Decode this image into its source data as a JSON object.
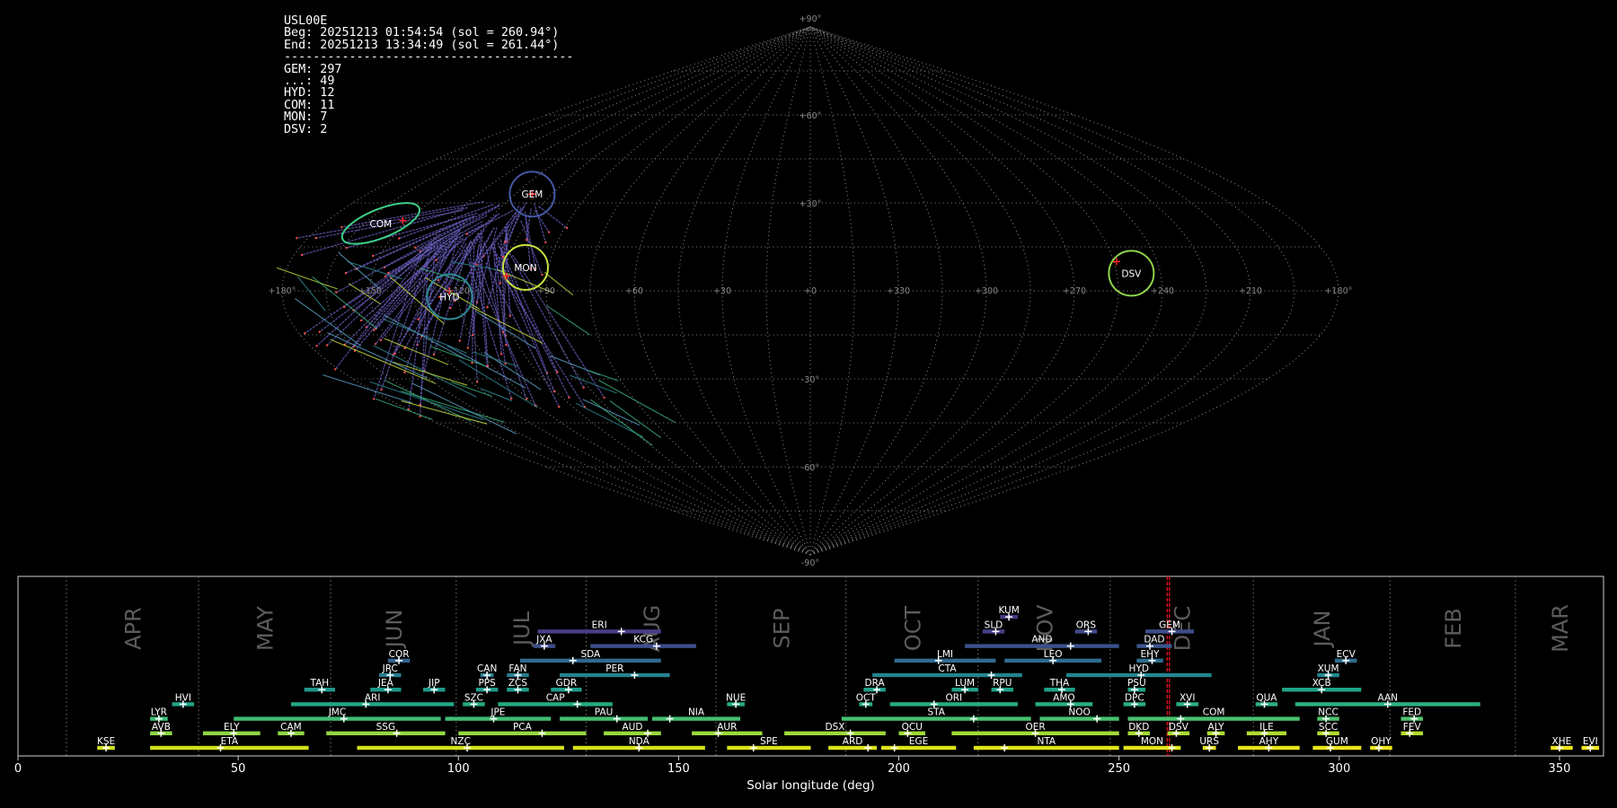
{
  "chart_data": [
    {
      "type": "scatter",
      "projection": "sinusoidal",
      "panel": "sky",
      "info_lines": [
        "USL00E",
        "Beg: 20251213 01:54:54 (sol = 260.94°)",
        "End: 20251213 13:34:49 (sol = 261.44°)",
        "----------------------------------------",
        "GEM: 297",
        "...: 49",
        "HYD: 12",
        "COM: 11",
        "MON: 7",
        "DSV: 2"
      ],
      "lon_tick_labels": [
        "+180°",
        "+150",
        "+120",
        "+90",
        "+60",
        "+30",
        "+0",
        "+330",
        "+300",
        "+270",
        "+240",
        "+210",
        "+180°"
      ],
      "lat_tick_labels": [
        "+90°",
        "+60°",
        "+30°",
        "-30°",
        "-60°",
        "-90°"
      ],
      "radiants": [
        {
          "code": "COM",
          "lon": 159,
          "lat": 23,
          "color": "#3ecf86",
          "marker_lon": 152,
          "marker_lat": 24
        },
        {
          "code": "GEM",
          "lon": 113,
          "lat": 33,
          "color": "#4458a0",
          "marker_lon": 113,
          "marker_lat": 33
        },
        {
          "code": "MON",
          "lon": 98,
          "lat": 8,
          "color": "#c8e040",
          "marker_lon": 104,
          "marker_lat": 5
        },
        {
          "code": "HYD",
          "lon": 123,
          "lat": -2,
          "color": "#2e8a96",
          "marker_lon": 123,
          "marker_lat": 0
        },
        {
          "code": "DSV",
          "lon": -110,
          "lat": 6,
          "color": "#8ed34a",
          "marker_lon": -106,
          "marker_lat": 10
        }
      ],
      "grid": true
    },
    {
      "type": "timeline",
      "panel": "shower-activity",
      "xlabel": "Solar longitude (deg)",
      "xlim": [
        0,
        360
      ],
      "x_ticks": [
        "0",
        "50",
        "100",
        "150",
        "200",
        "250",
        "300",
        "350"
      ],
      "x_tick_values": [
        0,
        50,
        100,
        150,
        200,
        250,
        300,
        350
      ],
      "months": [
        {
          "label": "APR",
          "start": 11,
          "end": 41
        },
        {
          "label": "MAY",
          "start": 41,
          "end": 71
        },
        {
          "label": "JUN",
          "start": 71,
          "end": 99.5
        },
        {
          "label": "JUL",
          "start": 99.5,
          "end": 129
        },
        {
          "label": "AUG",
          "start": 129,
          "end": 158.5
        },
        {
          "label": "SEP",
          "start": 158.5,
          "end": 188
        },
        {
          "label": "OCT",
          "start": 188,
          "end": 218
        },
        {
          "label": "NOV",
          "start": 218,
          "end": 248
        },
        {
          "label": "DEC",
          "start": 248,
          "end": 280.5
        },
        {
          "label": "JAN",
          "start": 280.5,
          "end": 311.5
        },
        {
          "label": "FEB",
          "start": 311.5,
          "end": 340
        },
        {
          "label": "MAR",
          "start": 340,
          "end": 370
        }
      ],
      "current_sol": [
        260.94,
        261.44
      ],
      "showers": [
        {
          "code": "KUM",
          "row": 9,
          "start": 223,
          "end": 227,
          "peak": 225,
          "color": "#483a84"
        },
        {
          "code": "ERI",
          "row": 8,
          "start": 118,
          "end": 146,
          "peak": 137,
          "color": "#463e86"
        },
        {
          "code": "SLD",
          "row": 8,
          "start": 219,
          "end": 224,
          "peak": 222,
          "color": "#443f87"
        },
        {
          "code": "ORS",
          "row": 8,
          "start": 240,
          "end": 245,
          "peak": 243,
          "color": "#3f4a8a"
        },
        {
          "code": "GEM",
          "row": 8,
          "start": 256,
          "end": 267,
          "peak": 262,
          "color": "#3d4d8a"
        },
        {
          "code": "JXA",
          "row": 7,
          "start": 117,
          "end": 122,
          "peak": 119.5,
          "color": "#3d4f8a"
        },
        {
          "code": "KCG",
          "row": 7,
          "start": 130,
          "end": 154,
          "peak": 145,
          "color": "#3d4f8a"
        },
        {
          "code": "AND",
          "row": 7,
          "start": 215,
          "end": 250,
          "peak": 239,
          "color": "#3b528b"
        },
        {
          "code": "DAD",
          "row": 7,
          "start": 254,
          "end": 262,
          "peak": 257,
          "color": "#39568c"
        },
        {
          "code": "COR",
          "row": 6,
          "start": 84,
          "end": 89,
          "peak": 86.5,
          "color": "#33638d"
        },
        {
          "code": "SDA",
          "row": 6,
          "start": 114,
          "end": 146,
          "peak": 126,
          "color": "#31688e"
        },
        {
          "code": "LMI",
          "row": 6,
          "start": 199,
          "end": 222,
          "peak": 209,
          "color": "#306a8e"
        },
        {
          "code": "LEO",
          "row": 6,
          "start": 224,
          "end": 246,
          "peak": 235,
          "color": "#2f6c8e"
        },
        {
          "code": "EHY",
          "row": 6,
          "start": 254,
          "end": 260,
          "peak": 257.5,
          "color": "#2f6d8e"
        },
        {
          "code": "ECV",
          "row": 6,
          "start": 299,
          "end": 304,
          "peak": 301.5,
          "color": "#2f6c8e"
        },
        {
          "code": "JRC",
          "row": 5,
          "start": 82,
          "end": 87,
          "peak": 84.5,
          "color": "#297b8e"
        },
        {
          "code": "CAN",
          "row": 5,
          "start": 105,
          "end": 108,
          "peak": 106.5,
          "color": "#287c8e"
        },
        {
          "code": "FAN",
          "row": 5,
          "start": 111,
          "end": 116,
          "peak": 113.5,
          "color": "#277f8e"
        },
        {
          "code": "PER",
          "row": 5,
          "start": 123,
          "end": 148,
          "peak": 140,
          "color": "#26818e"
        },
        {
          "code": "CTA",
          "row": 5,
          "start": 194,
          "end": 228,
          "peak": 221,
          "color": "#25848e"
        },
        {
          "code": "HYD",
          "row": 5,
          "start": 238,
          "end": 271,
          "peak": 255,
          "color": "#24868e"
        },
        {
          "code": "XUM",
          "row": 5,
          "start": 295,
          "end": 300,
          "peak": 297.5,
          "color": "#23888e"
        },
        {
          "code": "TAH",
          "row": 4,
          "start": 65,
          "end": 72,
          "peak": 69,
          "color": "#1f958b"
        },
        {
          "code": "JEA",
          "row": 4,
          "start": 80,
          "end": 87,
          "peak": 84,
          "color": "#1f968b"
        },
        {
          "code": "JIP",
          "row": 4,
          "start": 92,
          "end": 97,
          "peak": 94.5,
          "color": "#1f988b"
        },
        {
          "code": "PPS",
          "row": 4,
          "start": 104,
          "end": 109,
          "peak": 106.5,
          "color": "#1f9a8a"
        },
        {
          "code": "ZCS",
          "row": 4,
          "start": 111,
          "end": 116,
          "peak": 113.5,
          "color": "#1f9a8a"
        },
        {
          "code": "GDR",
          "row": 4,
          "start": 121,
          "end": 128,
          "peak": 125,
          "color": "#1f9b8a"
        },
        {
          "code": "DRA",
          "row": 4,
          "start": 192,
          "end": 197,
          "peak": 195,
          "color": "#1f9e89"
        },
        {
          "code": "LUM",
          "row": 4,
          "start": 212,
          "end": 218,
          "peak": 215,
          "color": "#1fa088"
        },
        {
          "code": "RPU",
          "row": 4,
          "start": 221,
          "end": 226,
          "peak": 223,
          "color": "#1fa088"
        },
        {
          "code": "THA",
          "row": 4,
          "start": 233,
          "end": 240,
          "peak": 237,
          "color": "#1fa187"
        },
        {
          "code": "PSU",
          "row": 4,
          "start": 252,
          "end": 256,
          "peak": 253.5,
          "color": "#1fa287"
        },
        {
          "code": "XCB",
          "row": 4,
          "start": 287,
          "end": 305,
          "peak": 296,
          "color": "#1fa287"
        },
        {
          "code": "HVI",
          "row": 3,
          "start": 35,
          "end": 40,
          "peak": 37.5,
          "color": "#20a386"
        },
        {
          "code": "ARI",
          "row": 3,
          "start": 62,
          "end": 99,
          "peak": 79,
          "color": "#22a785"
        },
        {
          "code": "SZC",
          "row": 3,
          "start": 101,
          "end": 106,
          "peak": 103.5,
          "color": "#23a983"
        },
        {
          "code": "CAP",
          "row": 3,
          "start": 109,
          "end": 135,
          "peak": 127,
          "color": "#24aa83"
        },
        {
          "code": "NUE",
          "row": 3,
          "start": 161,
          "end": 165,
          "peak": 163,
          "color": "#25ac82"
        },
        {
          "code": "OCT",
          "row": 3,
          "start": 191,
          "end": 194,
          "peak": 192.5,
          "color": "#26ad81"
        },
        {
          "code": "ORI",
          "row": 3,
          "start": 198,
          "end": 227,
          "peak": 208,
          "color": "#27ad81"
        },
        {
          "code": "AMO",
          "row": 3,
          "start": 231,
          "end": 244,
          "peak": 239,
          "color": "#28ae80"
        },
        {
          "code": "DPC",
          "row": 3,
          "start": 251,
          "end": 256,
          "peak": 253.5,
          "color": "#29af7f"
        },
        {
          "code": "XVI",
          "row": 3,
          "start": 263,
          "end": 268,
          "peak": 265.5,
          "color": "#2ab07f"
        },
        {
          "code": "QUA",
          "row": 3,
          "start": 281,
          "end": 286,
          "peak": 283,
          "color": "#2bb07f"
        },
        {
          "code": "AAN",
          "row": 3,
          "start": 290,
          "end": 332,
          "peak": 311,
          "color": "#2cb17e"
        },
        {
          "code": "LYR",
          "row": 2,
          "start": 30,
          "end": 34,
          "peak": 32,
          "color": "#3bbb75"
        },
        {
          "code": "JMC",
          "row": 2,
          "start": 49,
          "end": 96,
          "peak": 74,
          "color": "#3fbc73"
        },
        {
          "code": "JPE",
          "row": 2,
          "start": 97,
          "end": 121,
          "peak": 108,
          "color": "#40bd72"
        },
        {
          "code": "PAU",
          "row": 2,
          "start": 123,
          "end": 143,
          "peak": 136,
          "color": "#42be71"
        },
        {
          "code": "NIA",
          "row": 2,
          "start": 144,
          "end": 164,
          "peak": 148,
          "color": "#44bf70"
        },
        {
          "code": "STA",
          "row": 2,
          "start": 187,
          "end": 230,
          "peak": 217,
          "color": "#46c06f"
        },
        {
          "code": "NOO",
          "row": 2,
          "start": 232,
          "end": 250,
          "peak": 245,
          "color": "#48c16e"
        },
        {
          "code": "COM",
          "row": 2,
          "start": 252,
          "end": 291,
          "peak": 264,
          "color": "#4ac16d"
        },
        {
          "code": "NCC",
          "row": 2,
          "start": 295,
          "end": 300,
          "peak": 297,
          "color": "#4cc26c"
        },
        {
          "code": "FED",
          "row": 2,
          "start": 314,
          "end": 319,
          "peak": 317,
          "color": "#4ec36b"
        },
        {
          "code": "AVB",
          "row": 1,
          "start": 30,
          "end": 35,
          "peak": 32.5,
          "color": "#8bd646"
        },
        {
          "code": "ELY",
          "row": 1,
          "start": 42,
          "end": 55,
          "peak": 49,
          "color": "#8ed645"
        },
        {
          "code": "CAM",
          "row": 1,
          "start": 59,
          "end": 65,
          "peak": 62,
          "color": "#90d743"
        },
        {
          "code": "SSG",
          "row": 1,
          "start": 70,
          "end": 97,
          "peak": 86,
          "color": "#93d741"
        },
        {
          "code": "PCA",
          "row": 1,
          "start": 100,
          "end": 129,
          "peak": 119,
          "color": "#95d840"
        },
        {
          "code": "AUD",
          "row": 1,
          "start": 133,
          "end": 146,
          "peak": 143,
          "color": "#98d83e"
        },
        {
          "code": "AUR",
          "row": 1,
          "start": 153,
          "end": 169,
          "peak": 159,
          "color": "#9bd93c"
        },
        {
          "code": "DSX",
          "row": 1,
          "start": 174,
          "end": 197,
          "peak": 189,
          "color": "#9dd93b"
        },
        {
          "code": "OCU",
          "row": 1,
          "start": 200,
          "end": 206,
          "peak": 202,
          "color": "#a0da39"
        },
        {
          "code": "OER",
          "row": 1,
          "start": 212,
          "end": 250,
          "peak": 231,
          "color": "#a2da37"
        },
        {
          "code": "DKD",
          "row": 1,
          "start": 252,
          "end": 257,
          "peak": 254.5,
          "color": "#a5db36"
        },
        {
          "code": "DSV",
          "row": 1,
          "start": 261,
          "end": 266,
          "peak": 263,
          "color": "#a8db34"
        },
        {
          "code": "ALY",
          "row": 1,
          "start": 270,
          "end": 274,
          "peak": 272,
          "color": "#aadc32"
        },
        {
          "code": "ILE",
          "row": 1,
          "start": 279,
          "end": 288,
          "peak": 283,
          "color": "#addc30"
        },
        {
          "code": "SCC",
          "row": 1,
          "start": 295,
          "end": 300,
          "peak": 297,
          "color": "#b0dd2f"
        },
        {
          "code": "FEV",
          "row": 1,
          "start": 314,
          "end": 319,
          "peak": 316,
          "color": "#b2dd2d"
        },
        {
          "code": "KSE",
          "row": 0,
          "start": 18,
          "end": 22,
          "peak": 20,
          "color": "#cde11d"
        },
        {
          "code": "ETA",
          "row": 0,
          "start": 30,
          "end": 66,
          "peak": 46,
          "color": "#d0e11c"
        },
        {
          "code": "NZC",
          "row": 0,
          "start": 77,
          "end": 124,
          "peak": 102,
          "color": "#d2e21b"
        },
        {
          "code": "NDA",
          "row": 0,
          "start": 126,
          "end": 156,
          "peak": 141,
          "color": "#d5e21a"
        },
        {
          "code": "SPE",
          "row": 0,
          "start": 161,
          "end": 180,
          "peak": 167,
          "color": "#d8e219"
        },
        {
          "code": "ARD",
          "row": 0,
          "start": 184,
          "end": 195,
          "peak": 193,
          "color": "#dae319"
        },
        {
          "code": "EGE",
          "row": 0,
          "start": 196,
          "end": 213,
          "peak": 199,
          "color": "#dde318"
        },
        {
          "code": "NTA",
          "row": 0,
          "start": 217,
          "end": 250,
          "peak": 224,
          "color": "#dfe318"
        },
        {
          "code": "MON",
          "row": 0,
          "start": 251,
          "end": 264,
          "peak": 262,
          "color": "#e2e418"
        },
        {
          "code": "URS",
          "row": 0,
          "start": 269,
          "end": 272,
          "peak": 270.5,
          "color": "#e5e419"
        },
        {
          "code": "AHY",
          "row": 0,
          "start": 277,
          "end": 291,
          "peak": 284,
          "color": "#e7e419"
        },
        {
          "code": "GUM",
          "row": 0,
          "start": 294,
          "end": 305,
          "peak": 298,
          "color": "#eae51a"
        },
        {
          "code": "OHY",
          "row": 0,
          "start": 307,
          "end": 312,
          "peak": 309,
          "color": "#ece51b"
        },
        {
          "code": "XHE",
          "row": 0,
          "start": 348,
          "end": 353,
          "peak": 350,
          "color": "#efe51c"
        },
        {
          "code": "EVI",
          "row": 0,
          "start": 355,
          "end": 359,
          "peak": 357,
          "color": "#f1e51d"
        }
      ]
    }
  ]
}
